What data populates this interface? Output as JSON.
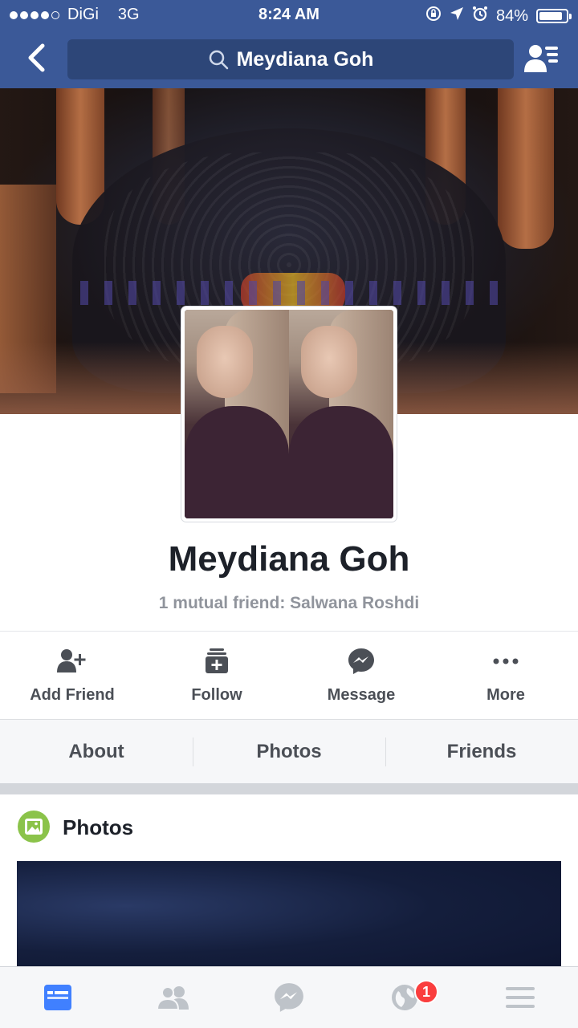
{
  "status_bar": {
    "carrier": "DiGi",
    "network": "3G",
    "time": "8:24 AM",
    "battery": "84%",
    "battery_level": 0.84
  },
  "nav": {
    "search_text": "Meydiana Goh",
    "icons": [
      "back-chevron-icon",
      "search-icon",
      "friend-requests-icon"
    ]
  },
  "profile": {
    "name": "Meydiana Goh",
    "mutual": "1 mutual friend: Salwana Roshdi"
  },
  "actions": [
    {
      "label": "Add Friend",
      "icon": "add-friend-icon"
    },
    {
      "label": "Follow",
      "icon": "follow-icon"
    },
    {
      "label": "Message",
      "icon": "messenger-icon"
    },
    {
      "label": "More",
      "icon": "more-icon"
    }
  ],
  "tabs": [
    "About",
    "Photos",
    "Friends"
  ],
  "photos_section": {
    "title": "Photos"
  },
  "bottom_nav": {
    "items": [
      "news-feed-icon",
      "friends-icon",
      "messenger-icon",
      "notifications-globe-icon",
      "menu-icon"
    ],
    "notification_badge": "1"
  },
  "colors": {
    "brand": "#3b5998",
    "search_bg": "#2d4678",
    "badge": "#fa3e3e",
    "icon_gray": "#4b4f56",
    "active_tab": "#4080ff"
  }
}
